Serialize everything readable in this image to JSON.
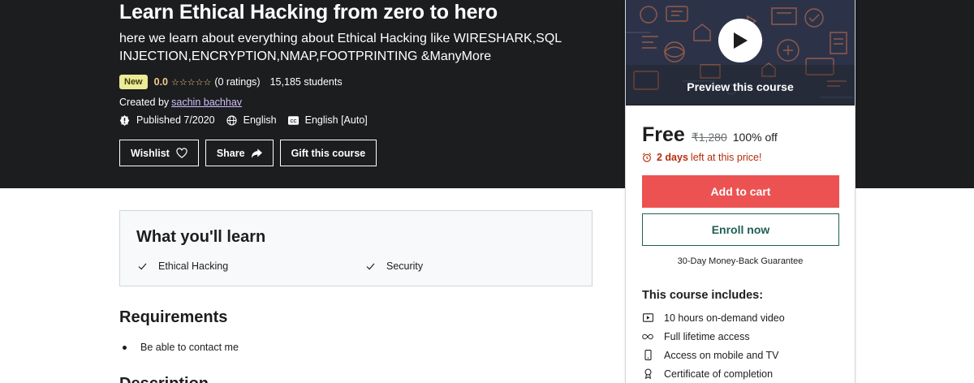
{
  "hero": {
    "title": "Learn Ethical Hacking from zero to hero",
    "subtitle": "here we learn about everything about Ethical Hacking like WIRESHARK,SQL INJECTION,ENCRYPTION,NMAP,FOOTPRINTING &ManyMore",
    "badge": "New",
    "rating": "0.0",
    "stars": "☆☆☆☆☆",
    "rating_count": "(0 ratings)",
    "students": "15,185 students",
    "created_by_label": "Created by",
    "instructor": "sachin bachhav",
    "published": "Published 7/2020",
    "language": "English",
    "captions": "English [Auto]",
    "buttons": {
      "wishlist": "Wishlist",
      "share": "Share",
      "gift": "Gift this course"
    }
  },
  "sidebar": {
    "preview_label": "Preview this course",
    "price": "Free",
    "original_price": "₹1,280",
    "discount": "100% off",
    "urgency_strong": "2 days",
    "urgency_rest": "left at this price!",
    "add_to_cart": "Add to cart",
    "enroll_now": "Enroll now",
    "guarantee": "30-Day Money-Back Guarantee",
    "includes_title": "This course includes:",
    "includes": [
      {
        "icon": "video-icon",
        "label": "10 hours on-demand video"
      },
      {
        "icon": "infinity-icon",
        "label": "Full lifetime access"
      },
      {
        "icon": "mobile-icon",
        "label": "Access on mobile and TV"
      },
      {
        "icon": "certificate-icon",
        "label": "Certificate of completion"
      }
    ]
  },
  "learn": {
    "title": "What you'll learn",
    "items": [
      "Ethical Hacking",
      "Security"
    ]
  },
  "requirements": {
    "title": "Requirements",
    "items": [
      "Be able to contact me"
    ]
  },
  "description": {
    "title": "Description"
  },
  "colors": {
    "hero_bg": "#1c1d1f",
    "accent_red": "#ec5252",
    "enroll_teal": "#1e6055",
    "star": "#f3ca8c",
    "badge_bg": "#eceb98",
    "urgency": "#b32d0f"
  }
}
